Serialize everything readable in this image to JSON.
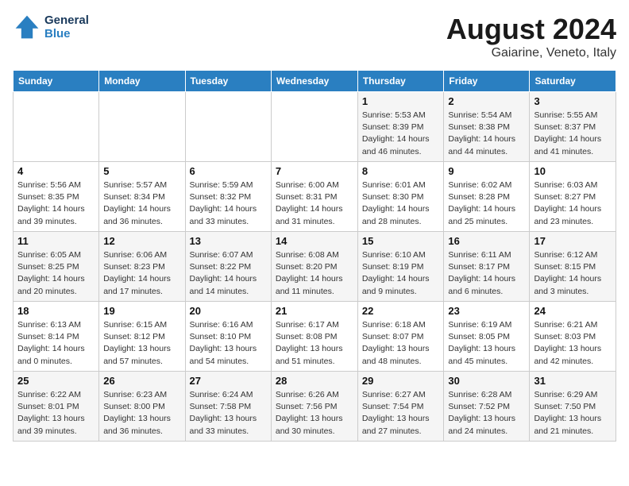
{
  "logo": {
    "line1": "General",
    "line2": "Blue"
  },
  "title": "August 2024",
  "location": "Gaiarine, Veneto, Italy",
  "days_of_week": [
    "Sunday",
    "Monday",
    "Tuesday",
    "Wednesday",
    "Thursday",
    "Friday",
    "Saturday"
  ],
  "weeks": [
    [
      {
        "day": "",
        "detail": ""
      },
      {
        "day": "",
        "detail": ""
      },
      {
        "day": "",
        "detail": ""
      },
      {
        "day": "",
        "detail": ""
      },
      {
        "day": "1",
        "detail": "Sunrise: 5:53 AM\nSunset: 8:39 PM\nDaylight: 14 hours\nand 46 minutes."
      },
      {
        "day": "2",
        "detail": "Sunrise: 5:54 AM\nSunset: 8:38 PM\nDaylight: 14 hours\nand 44 minutes."
      },
      {
        "day": "3",
        "detail": "Sunrise: 5:55 AM\nSunset: 8:37 PM\nDaylight: 14 hours\nand 41 minutes."
      }
    ],
    [
      {
        "day": "4",
        "detail": "Sunrise: 5:56 AM\nSunset: 8:35 PM\nDaylight: 14 hours\nand 39 minutes."
      },
      {
        "day": "5",
        "detail": "Sunrise: 5:57 AM\nSunset: 8:34 PM\nDaylight: 14 hours\nand 36 minutes."
      },
      {
        "day": "6",
        "detail": "Sunrise: 5:59 AM\nSunset: 8:32 PM\nDaylight: 14 hours\nand 33 minutes."
      },
      {
        "day": "7",
        "detail": "Sunrise: 6:00 AM\nSunset: 8:31 PM\nDaylight: 14 hours\nand 31 minutes."
      },
      {
        "day": "8",
        "detail": "Sunrise: 6:01 AM\nSunset: 8:30 PM\nDaylight: 14 hours\nand 28 minutes."
      },
      {
        "day": "9",
        "detail": "Sunrise: 6:02 AM\nSunset: 8:28 PM\nDaylight: 14 hours\nand 25 minutes."
      },
      {
        "day": "10",
        "detail": "Sunrise: 6:03 AM\nSunset: 8:27 PM\nDaylight: 14 hours\nand 23 minutes."
      }
    ],
    [
      {
        "day": "11",
        "detail": "Sunrise: 6:05 AM\nSunset: 8:25 PM\nDaylight: 14 hours\nand 20 minutes."
      },
      {
        "day": "12",
        "detail": "Sunrise: 6:06 AM\nSunset: 8:23 PM\nDaylight: 14 hours\nand 17 minutes."
      },
      {
        "day": "13",
        "detail": "Sunrise: 6:07 AM\nSunset: 8:22 PM\nDaylight: 14 hours\nand 14 minutes."
      },
      {
        "day": "14",
        "detail": "Sunrise: 6:08 AM\nSunset: 8:20 PM\nDaylight: 14 hours\nand 11 minutes."
      },
      {
        "day": "15",
        "detail": "Sunrise: 6:10 AM\nSunset: 8:19 PM\nDaylight: 14 hours\nand 9 minutes."
      },
      {
        "day": "16",
        "detail": "Sunrise: 6:11 AM\nSunset: 8:17 PM\nDaylight: 14 hours\nand 6 minutes."
      },
      {
        "day": "17",
        "detail": "Sunrise: 6:12 AM\nSunset: 8:15 PM\nDaylight: 14 hours\nand 3 minutes."
      }
    ],
    [
      {
        "day": "18",
        "detail": "Sunrise: 6:13 AM\nSunset: 8:14 PM\nDaylight: 14 hours\nand 0 minutes."
      },
      {
        "day": "19",
        "detail": "Sunrise: 6:15 AM\nSunset: 8:12 PM\nDaylight: 13 hours\nand 57 minutes."
      },
      {
        "day": "20",
        "detail": "Sunrise: 6:16 AM\nSunset: 8:10 PM\nDaylight: 13 hours\nand 54 minutes."
      },
      {
        "day": "21",
        "detail": "Sunrise: 6:17 AM\nSunset: 8:08 PM\nDaylight: 13 hours\nand 51 minutes."
      },
      {
        "day": "22",
        "detail": "Sunrise: 6:18 AM\nSunset: 8:07 PM\nDaylight: 13 hours\nand 48 minutes."
      },
      {
        "day": "23",
        "detail": "Sunrise: 6:19 AM\nSunset: 8:05 PM\nDaylight: 13 hours\nand 45 minutes."
      },
      {
        "day": "24",
        "detail": "Sunrise: 6:21 AM\nSunset: 8:03 PM\nDaylight: 13 hours\nand 42 minutes."
      }
    ],
    [
      {
        "day": "25",
        "detail": "Sunrise: 6:22 AM\nSunset: 8:01 PM\nDaylight: 13 hours\nand 39 minutes."
      },
      {
        "day": "26",
        "detail": "Sunrise: 6:23 AM\nSunset: 8:00 PM\nDaylight: 13 hours\nand 36 minutes."
      },
      {
        "day": "27",
        "detail": "Sunrise: 6:24 AM\nSunset: 7:58 PM\nDaylight: 13 hours\nand 33 minutes."
      },
      {
        "day": "28",
        "detail": "Sunrise: 6:26 AM\nSunset: 7:56 PM\nDaylight: 13 hours\nand 30 minutes."
      },
      {
        "day": "29",
        "detail": "Sunrise: 6:27 AM\nSunset: 7:54 PM\nDaylight: 13 hours\nand 27 minutes."
      },
      {
        "day": "30",
        "detail": "Sunrise: 6:28 AM\nSunset: 7:52 PM\nDaylight: 13 hours\nand 24 minutes."
      },
      {
        "day": "31",
        "detail": "Sunrise: 6:29 AM\nSunset: 7:50 PM\nDaylight: 13 hours\nand 21 minutes."
      }
    ]
  ]
}
